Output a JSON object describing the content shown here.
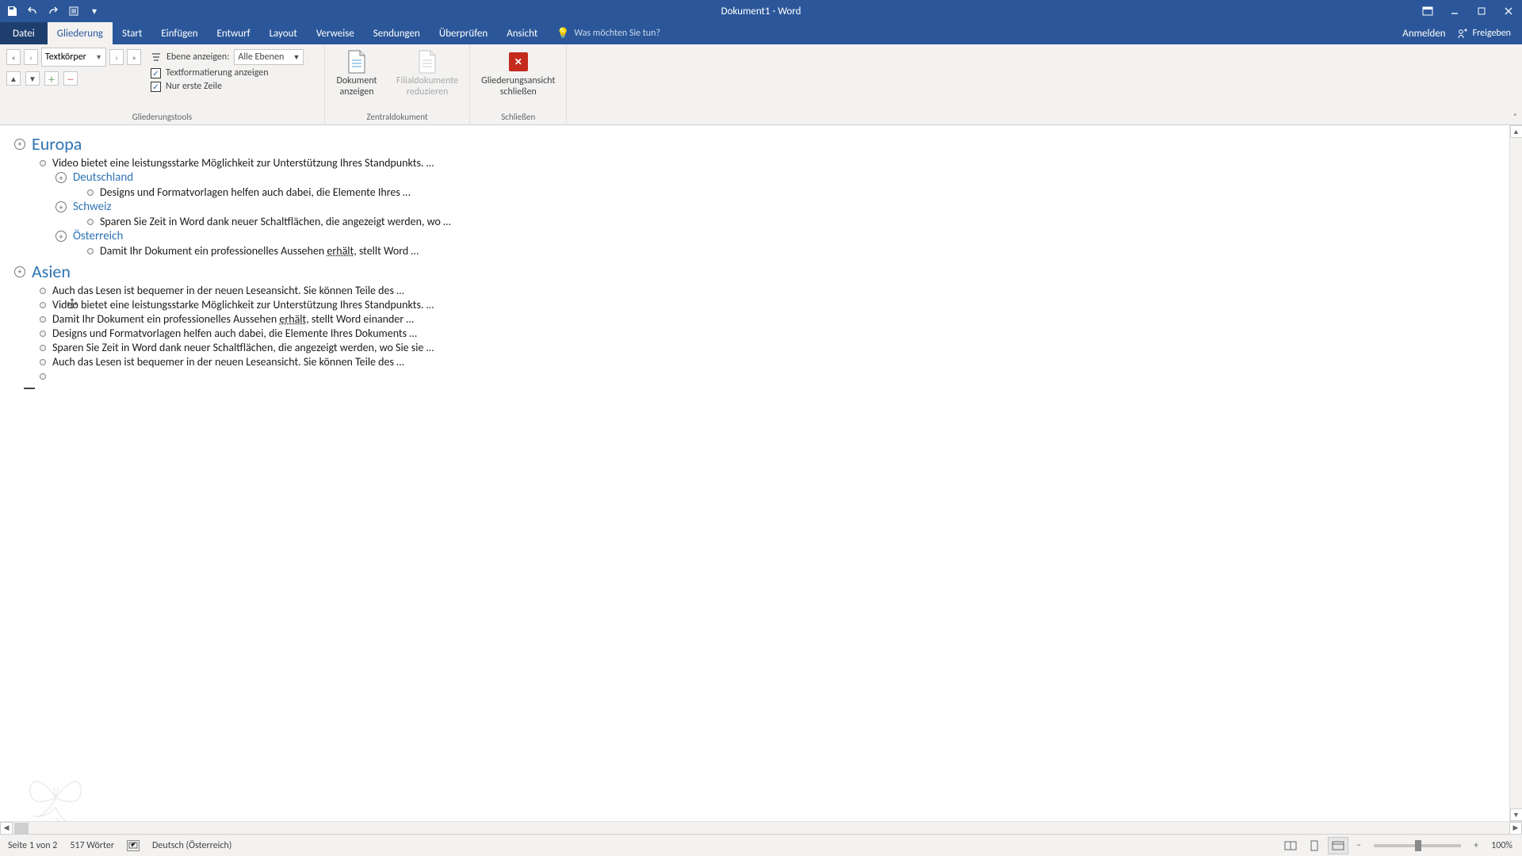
{
  "title": "Dokument1 - Word",
  "tabs": {
    "file": "Datei",
    "items": [
      "Gliederung",
      "Start",
      "Einfügen",
      "Entwurf",
      "Layout",
      "Verweise",
      "Sendungen",
      "Überprüfen",
      "Ansicht"
    ],
    "active": "Gliederung",
    "tell_me_placeholder": "Was möchten Sie tun?",
    "signin": "Anmelden",
    "share": "Freigeben"
  },
  "ribbon": {
    "group1": {
      "level_value": "Textkörper",
      "label": "Gliederungstools",
      "show_level_label": "Ebene anzeigen:",
      "show_level_value": "Alle Ebenen",
      "chk_formatting": "Textformatierung anzeigen",
      "chk_firstline": "Nur erste Zeile"
    },
    "group2": {
      "doc_show": "Dokument\nanzeigen",
      "subdoc_reduce": "Filialdokumente\nreduzieren",
      "label": "Zentraldokument"
    },
    "group3": {
      "close_outline": "Gliederungsansicht\nschließen",
      "label": "Schließen"
    }
  },
  "outline": {
    "europa": "Europa",
    "europa_body": "Video bietet eine leistungsstarke Möglichkeit zur Unterstützung Ihres Standpunkts. …",
    "de": "Deutschland",
    "de_body": "Designs und Formatvorlagen helfen auch dabei, die Elemente Ihres …",
    "ch": "Schweiz",
    "ch_body": "Sparen Sie Zeit in Word dank neuer Schaltflächen, die angezeigt werden, wo …",
    "at": "Österreich",
    "at_body_pre": "Damit Ihr Dokument ein professionelles Aussehen ",
    "at_body_underlined": "erhält",
    "at_body_post": ", stellt Word …",
    "asien": "Asien",
    "asien_items": [
      "Auch das Lesen ist bequemer in der neuen Leseansicht. Sie können Teile des …",
      "Video bietet eine leistungsstarke Möglichkeit zur Unterstützung Ihres Standpunkts. …",
      "",
      "Designs und Formatvorlagen helfen auch dabei, die Elemente Ihres Dokuments …",
      "Sparen Sie Zeit in Word dank neuer Schaltflächen, die angezeigt werden, wo Sie sie …",
      "Auch das Lesen ist bequemer in der neuen Leseansicht. Sie können Teile des …"
    ],
    "asien_item3_pre": "Damit Ihr Dokument ein professionelles Aussehen ",
    "asien_item3_under": "erhält",
    "asien_item3_post": ", stellt Word einander …"
  },
  "status": {
    "page": "Seite 1 von 2",
    "words": "517 Wörter",
    "language": "Deutsch (Österreich)",
    "zoom": "100%"
  }
}
